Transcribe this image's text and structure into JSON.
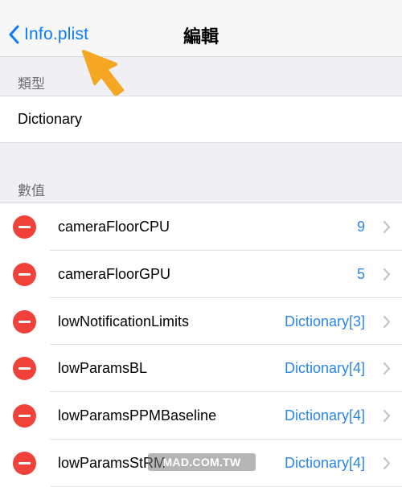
{
  "navbar": {
    "back_label": "Info.plist",
    "title": "編輯"
  },
  "type_section": {
    "header": "類型",
    "value": "Dictionary"
  },
  "values_section": {
    "header": "數值",
    "rows": [
      {
        "key": "cameraFloorCPU",
        "value": "9"
      },
      {
        "key": "cameraFloorGPU",
        "value": "5"
      },
      {
        "key": "lowNotificationLimits",
        "value": "Dictionary[3]"
      },
      {
        "key": "lowParamsBL",
        "value": "Dictionary[4]"
      },
      {
        "key": "lowParamsPPMBaseline",
        "value": "Dictionary[4]"
      },
      {
        "key": "lowParamsStRM",
        "value": "Dictionary[4]"
      }
    ]
  },
  "watermark": "MAD.COM.TW",
  "colors": {
    "accent": "#0a7aff",
    "value_blue": "#2a86e8",
    "delete_red": "#f0413b",
    "annotation_arrow": "#f5a623"
  }
}
